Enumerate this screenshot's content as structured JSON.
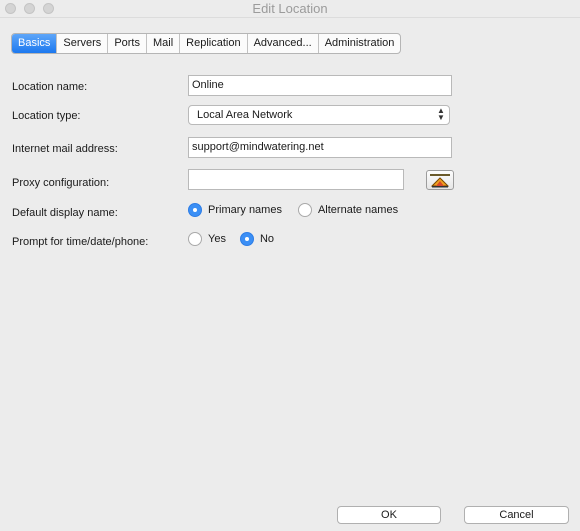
{
  "window": {
    "title": "Edit Location"
  },
  "tabs": [
    {
      "label": "Basics",
      "active": true
    },
    {
      "label": "Servers"
    },
    {
      "label": "Ports"
    },
    {
      "label": "Mail"
    },
    {
      "label": "Replication"
    },
    {
      "label": "Advanced..."
    },
    {
      "label": "Administration"
    }
  ],
  "form": {
    "location_name_label": "Location name:",
    "location_name_value": "Online",
    "location_type_label": "Location type:",
    "location_type_value": "Local Area Network",
    "internet_mail_label": "Internet mail address:",
    "internet_mail_value": "support@mindwatering.net",
    "proxy_label": "Proxy configuration:",
    "proxy_value": "",
    "display_name_label": "Default display name:",
    "display_name_options": [
      "Primary names",
      "Alternate names"
    ],
    "display_name_selected": "Primary names",
    "prompt_label": "Prompt for time/date/phone:",
    "prompt_options": [
      "Yes",
      "No"
    ],
    "prompt_selected": "No"
  },
  "buttons": {
    "ok": "OK",
    "cancel": "Cancel"
  },
  "colors": {
    "accent": "#1c78ef",
    "background": "#ececec"
  },
  "icons": {
    "proxy_button": "proxy-settings-icon"
  }
}
